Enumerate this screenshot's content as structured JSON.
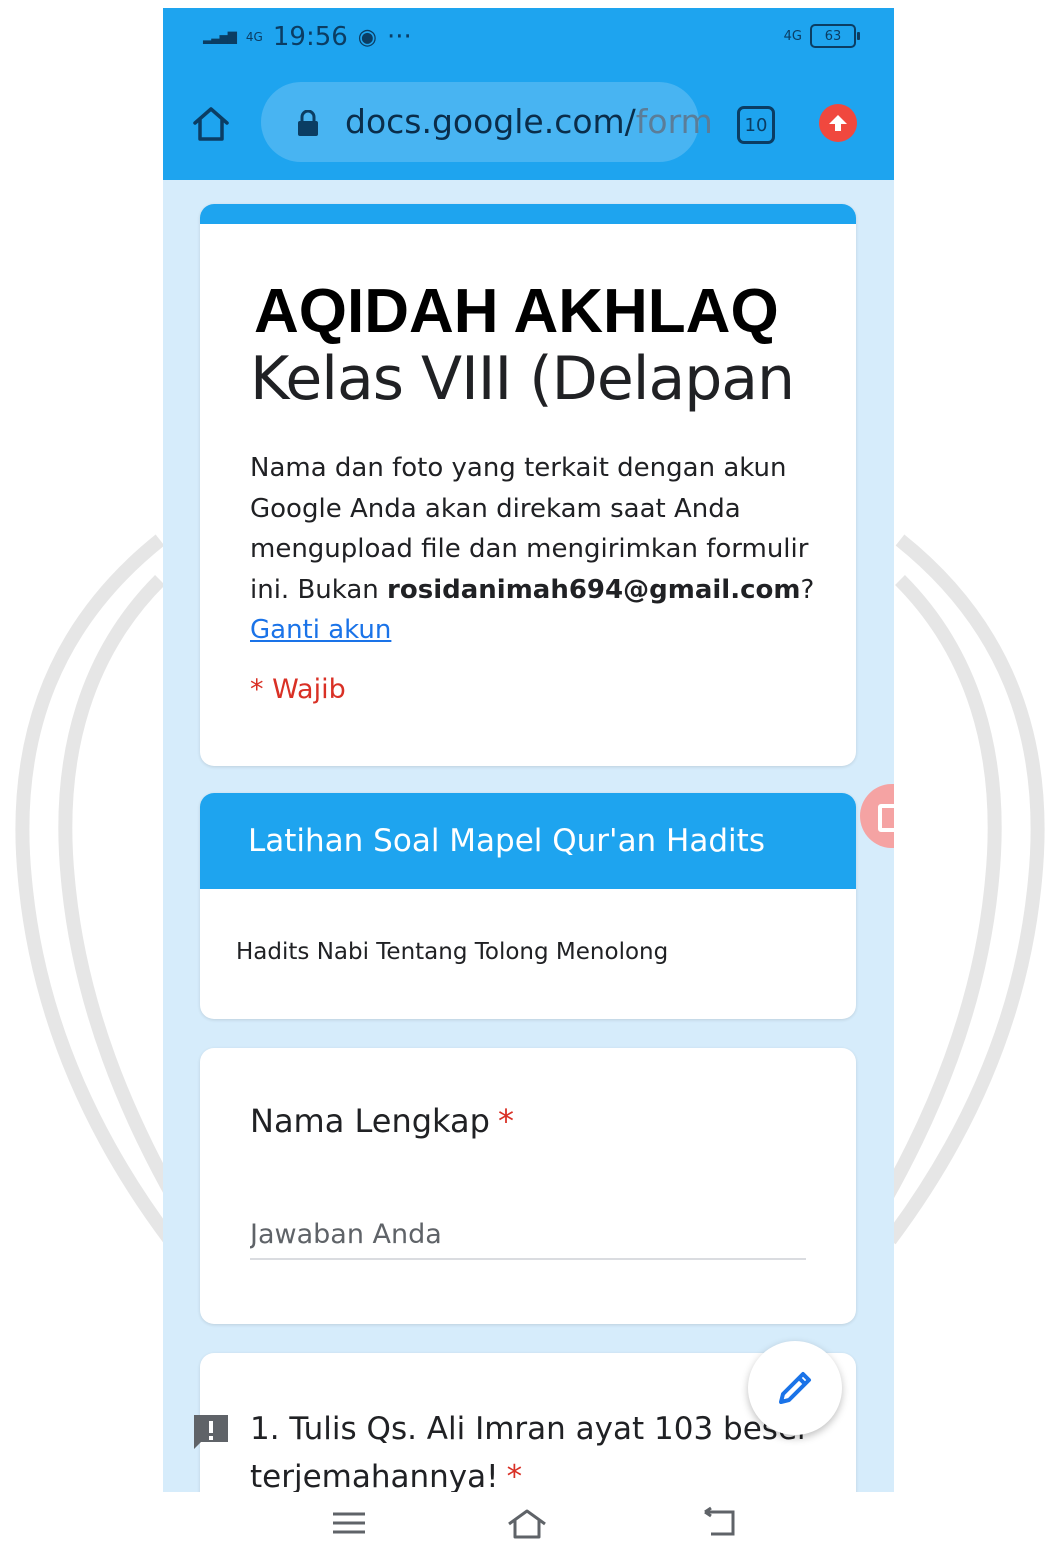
{
  "status_bar": {
    "network_left": "4G",
    "time": "19:56",
    "more": "···",
    "network_right": "4G",
    "battery": "63"
  },
  "browser": {
    "url_main": "docs.google.com/",
    "url_faded": "form",
    "tab_count": "10",
    "accent_color": "#1ea4ef",
    "upload_color": "#f0483e"
  },
  "form": {
    "title_line1": "AQIDAH AKHLAQ",
    "title_line2": "Kelas VIII (Delapan",
    "desc_part1": "Nama dan foto yang terkait dengan akun Google Anda akan direkam saat Anda mengupload file dan mengirimkan formulir ini. Bukan ",
    "account_email": "rosidanimah694@gmail.com",
    "desc_part2": "?",
    "switch_account": "Ganti akun",
    "required_note": "* Wajib",
    "required_color": "#d93025"
  },
  "section": {
    "title": "Latihan Soal Mapel Qur'an Hadits",
    "description": "Hadits Nabi Tentang Tolong Menolong"
  },
  "questions": [
    {
      "label": "Nama Lengkap",
      "required_mark": "*",
      "placeholder": "Jawaban Anda"
    },
    {
      "line1": "1. Tulis Qs. Ali Imran ayat 103 beser",
      "line2": "terjemahannya!",
      "required_mark": "*"
    }
  ],
  "icons": {
    "home": "home-icon",
    "lock": "lock-icon",
    "upload": "upload-icon",
    "edit": "pencil-icon",
    "alert": "feedback-icon",
    "nav_menu": "menu-icon",
    "nav_home": "home-nav-icon",
    "nav_back": "back-icon"
  }
}
